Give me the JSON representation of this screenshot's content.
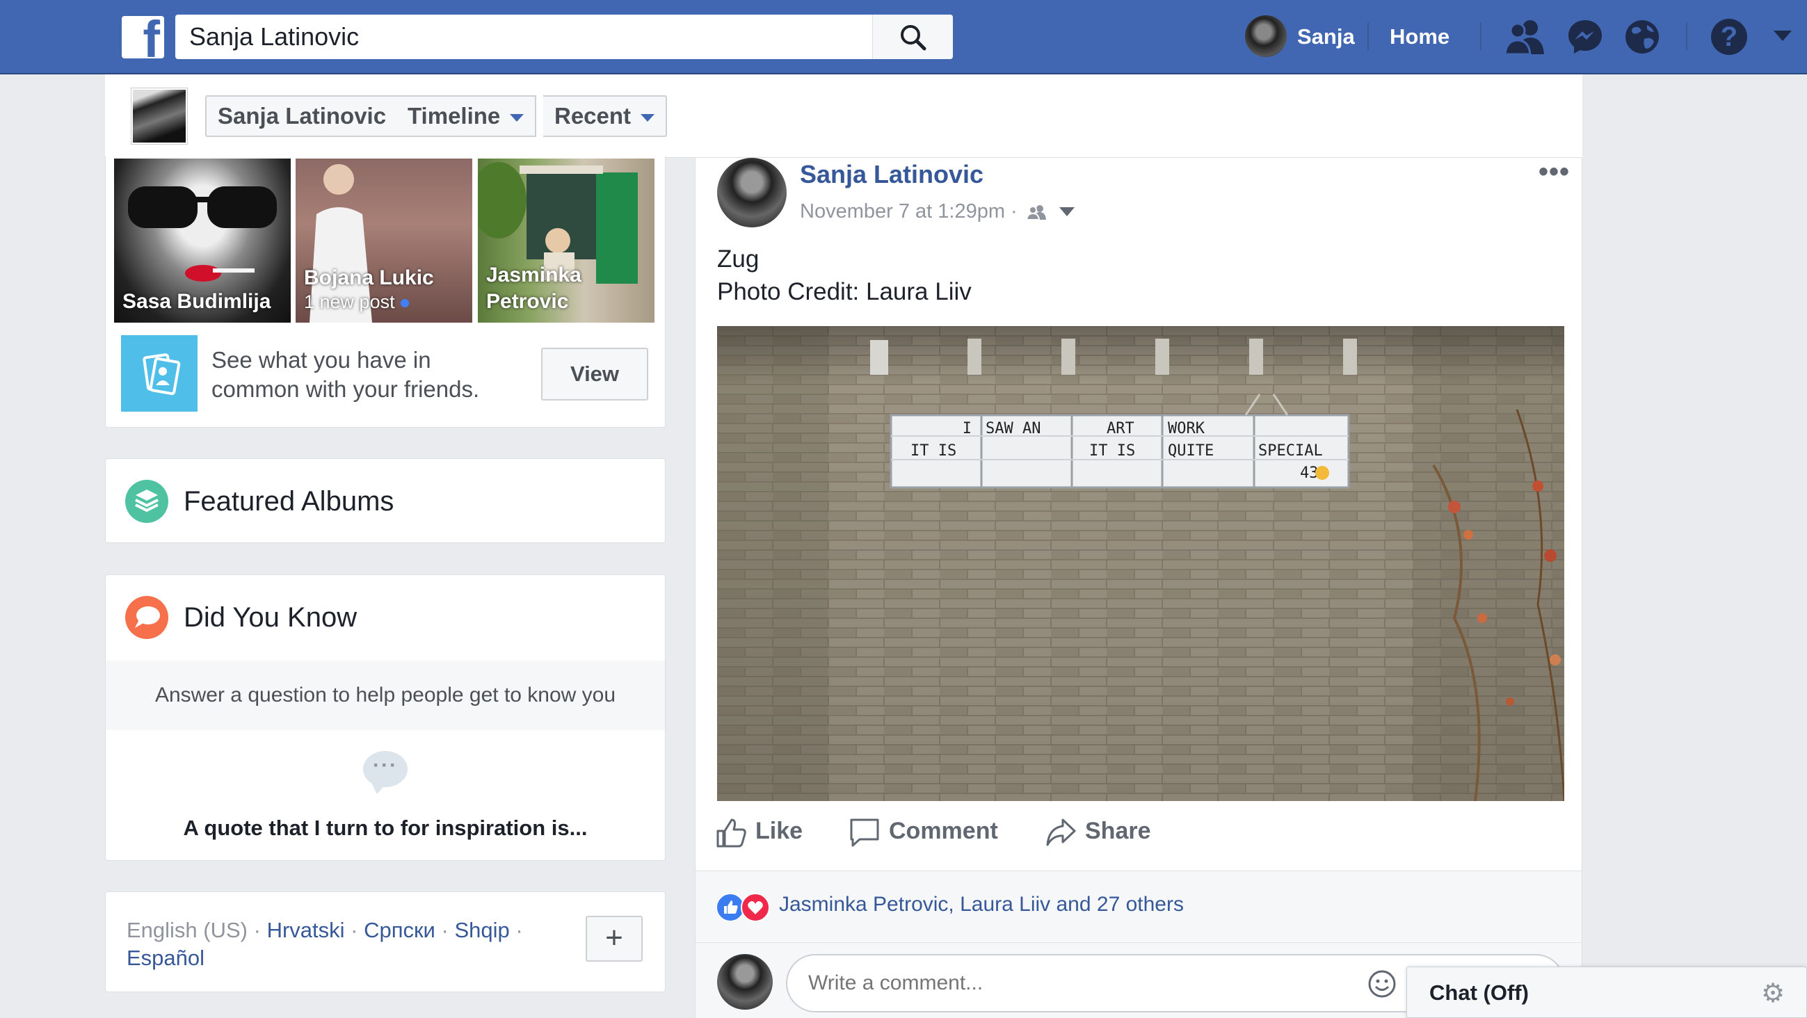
{
  "topbar": {
    "search_value": "Sanja Latinovic",
    "user_name": "Sanja",
    "home_label": "Home"
  },
  "subnav": {
    "name": "Sanja Latinovic",
    "timeline": "Timeline",
    "recent": "Recent"
  },
  "friends": [
    {
      "name": "Sasa Budimlija",
      "sub": ""
    },
    {
      "name": "Bojana Lukic",
      "sub": "1 new post"
    },
    {
      "name": "Jasminka",
      "name2": "Petrovic",
      "sub": ""
    }
  ],
  "common": {
    "text": "See what you have in common with your friends.",
    "button": "View"
  },
  "featured_albums": {
    "title": "Featured Albums"
  },
  "did_you_know": {
    "title": "Did You Know",
    "prompt": "Answer a question to help people get to know you",
    "quote": "A quote that I turn to for inspiration is..."
  },
  "languages": {
    "current": "English (US)",
    "sep": " · ",
    "others": [
      "Hrvatski",
      "Српски",
      "Shqip",
      "Español"
    ],
    "add": "+"
  },
  "post": {
    "author": "Sanja Latinovic",
    "time": "November 7 at 1:29pm",
    "meta_sep": " · ",
    "text_line1": "Zug",
    "text_line2": "Photo Credit: Laura Liiv",
    "sign": {
      "row1": [
        "I",
        "SAW    AN",
        "ART",
        "WORK",
        ""
      ],
      "row2": [
        "IT IS",
        "",
        "IT IS",
        "QUITE",
        "SPECIAL"
      ],
      "row3": [
        "",
        "",
        "",
        "",
        "43"
      ]
    },
    "like": "Like",
    "comment": "Comment",
    "share": "Share",
    "reactions_text": "Jasminka Petrovic, Laura Liiv and 27 others",
    "comment_placeholder": "Write a comment..."
  },
  "chat": {
    "label": "Chat (Off)"
  },
  "colors": {
    "brand": "#4267b2",
    "link": "#365899",
    "featured_icon": "#4fc3a1",
    "dyk_icon": "#f7704c",
    "common_icon": "#4fbfe9"
  }
}
